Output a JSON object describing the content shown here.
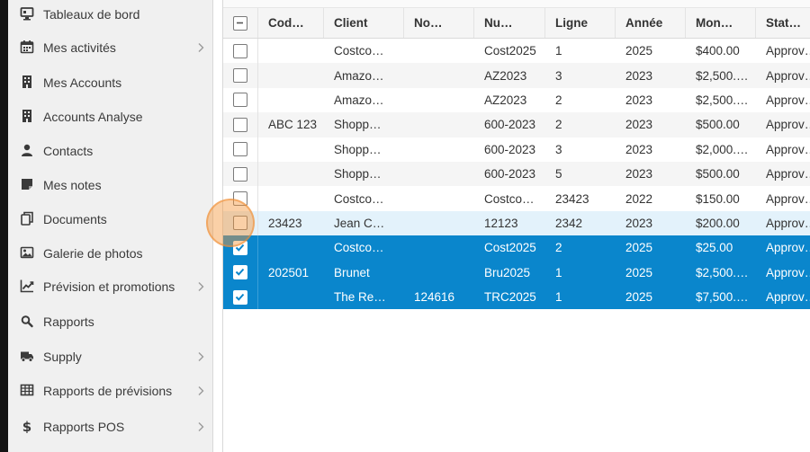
{
  "sidebar": {
    "items": [
      {
        "label": "Tableaux de bord",
        "icon": "dashboard-monitor-icon",
        "chevron": false
      },
      {
        "label": "Mes activités",
        "icon": "calendar-icon",
        "chevron": true
      },
      {
        "label": "Mes Accounts",
        "icon": "building-icon",
        "chevron": false
      },
      {
        "label": "Accounts Analyse",
        "icon": "building-icon",
        "chevron": false
      },
      {
        "label": "Contacts",
        "icon": "person-icon",
        "chevron": false
      },
      {
        "label": "Mes notes",
        "icon": "note-icon",
        "chevron": false
      },
      {
        "label": "Documents",
        "icon": "documents-icon",
        "chevron": false
      },
      {
        "label": "Galerie de photos",
        "icon": "image-icon",
        "chevron": false
      },
      {
        "label": "Prévision et promotions",
        "icon": "trend-chart-icon",
        "chevron": true
      },
      {
        "label": "Rapports",
        "icon": "search-icon",
        "chevron": false
      },
      {
        "label": "Supply",
        "icon": "truck-icon",
        "chevron": true
      },
      {
        "label": "Rapports de prévisions",
        "icon": "table-icon",
        "chevron": true
      },
      {
        "label": "Rapports POS",
        "icon": "dollar-icon",
        "chevron": true
      }
    ]
  },
  "grid": {
    "columns": [
      "Cod…",
      "Client",
      "No…",
      "Nu…",
      "Ligne",
      "Année",
      "Mon…",
      "Stat…"
    ],
    "rows": [
      {
        "cells": [
          "",
          "Costco…",
          "",
          "Cost2025",
          "1",
          "2025",
          "$400.00",
          "Approv…"
        ],
        "state": "normal"
      },
      {
        "cells": [
          "",
          "Amazo…",
          "",
          "AZ2023",
          "3",
          "2023",
          "$2,500.…",
          "Approv…"
        ],
        "state": "alt"
      },
      {
        "cells": [
          "",
          "Amazo…",
          "",
          "AZ2023",
          "2",
          "2023",
          "$2,500.…",
          "Approv…"
        ],
        "state": "normal"
      },
      {
        "cells": [
          "ABC 123",
          "Shopp…",
          "",
          "600-2023",
          "2",
          "2023",
          "$500.00",
          "Approv…"
        ],
        "state": "alt"
      },
      {
        "cells": [
          "",
          "Shopp…",
          "",
          "600-2023",
          "3",
          "2023",
          "$2,000.…",
          "Approv…"
        ],
        "state": "normal"
      },
      {
        "cells": [
          "",
          "Shopp…",
          "",
          "600-2023",
          "5",
          "2023",
          "$500.00",
          "Approv…"
        ],
        "state": "alt"
      },
      {
        "cells": [
          "",
          "Costco…",
          "",
          "Costco…",
          "23423",
          "2022",
          "$150.00",
          "Approv…"
        ],
        "state": "normal"
      },
      {
        "cells": [
          "23423",
          "Jean C…",
          "",
          "12123",
          "2342",
          "2023",
          "$200.00",
          "Approv…"
        ],
        "state": "hover"
      },
      {
        "cells": [
          "",
          "Costco…",
          "",
          "Cost2025",
          "2",
          "2025",
          "$25.00",
          "Approv…"
        ],
        "state": "selected"
      },
      {
        "cells": [
          "202501",
          "Brunet",
          "",
          "Bru2025",
          "1",
          "2025",
          "$2,500.…",
          "Approv…"
        ],
        "state": "selected"
      },
      {
        "cells": [
          "",
          "The Re…",
          "124616",
          "TRC2025",
          "1",
          "2025",
          "$7,500.…",
          "Approv…"
        ],
        "state": "selected"
      }
    ]
  },
  "colors": {
    "selected_row": "#0a86cc",
    "hover_row": "#e3f2fb",
    "alt_row": "#f5f5f5",
    "cursor_highlight": "#f5963c"
  }
}
